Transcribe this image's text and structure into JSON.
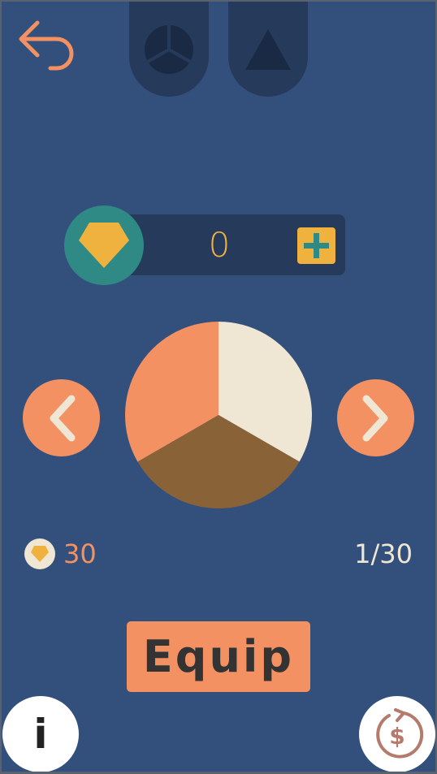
{
  "colors": {
    "background": "#33507c",
    "panel": "#263a5c",
    "accent_orange": "#f39163",
    "gem_yellow": "#efb23e",
    "teal": "#2f8a86",
    "slice_cream": "#f0e6d4",
    "slice_brown": "#8a6237",
    "slice_orange": "#f39163"
  },
  "top_tabs": [
    {
      "icon": "pie-shape-icon"
    },
    {
      "icon": "triangle-shape-icon"
    }
  ],
  "gems": {
    "count": "0",
    "add_icon": "plus-icon"
  },
  "preview": {
    "shape": "pie-3-slices",
    "price": "30",
    "index": "1/30"
  },
  "buttons": {
    "equip_label": "Equip",
    "info_label": "i",
    "back_icon": "back-arrow-icon",
    "prev_icon": "chevron-left-icon",
    "next_icon": "chevron-right-icon",
    "shop_icon": "refresh-dollar-icon"
  }
}
